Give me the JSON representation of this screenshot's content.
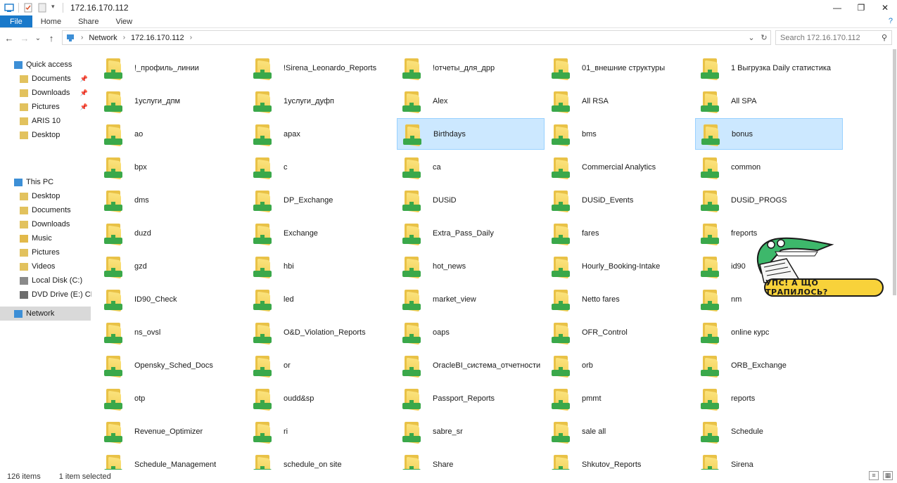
{
  "window": {
    "title": "172.16.170.112"
  },
  "ribbon": {
    "tabs": [
      "File",
      "Home",
      "Share",
      "View"
    ],
    "help_label": "?"
  },
  "nav": {
    "back": "←",
    "forward": "→",
    "recent": "⌄",
    "up": "↑"
  },
  "address": {
    "crumbs": [
      "Network",
      "172.16.170.112"
    ],
    "dropdown": "⌄",
    "refresh": "↻"
  },
  "search": {
    "placeholder": "Search 172.16.170.112"
  },
  "sidebar": {
    "items": [
      {
        "label": "Quick access",
        "icon": "star-icon",
        "pinned": false
      },
      {
        "label": "Documents",
        "icon": "documents-folder-icon",
        "pinned": true
      },
      {
        "label": "Downloads",
        "icon": "downloads-folder-icon",
        "pinned": true
      },
      {
        "label": "Pictures",
        "icon": "pictures-folder-icon",
        "pinned": true
      },
      {
        "label": "ARIS 10",
        "icon": "folder-icon",
        "pinned": false
      },
      {
        "label": "Desktop",
        "icon": "desktop-folder-icon",
        "pinned": false
      },
      {
        "label": "This PC",
        "icon": "computer-icon",
        "pinned": false
      },
      {
        "label": "Desktop",
        "icon": "desktop-folder-icon",
        "pinned": false
      },
      {
        "label": "Documents",
        "icon": "documents-folder-icon",
        "pinned": false
      },
      {
        "label": "Downloads",
        "icon": "downloads-folder-icon",
        "pinned": false
      },
      {
        "label": "Music",
        "icon": "music-folder-icon",
        "pinned": false
      },
      {
        "label": "Pictures",
        "icon": "pictures-folder-icon",
        "pinned": false
      },
      {
        "label": "Videos",
        "icon": "videos-folder-icon",
        "pinned": false
      },
      {
        "label": "Local Disk (C:)",
        "icon": "disk-icon",
        "pinned": false
      },
      {
        "label": "DVD Drive (E:) CDRO",
        "icon": "dvd-drive-icon",
        "pinned": false
      },
      {
        "label": "Network",
        "icon": "network-icon",
        "pinned": false
      }
    ]
  },
  "folders": [
    "!_профиль_линии",
    "!Sirena_Leonardo_Reports",
    "!отчеты_для_дрр",
    "01_внешние структуры",
    "1 Выгрузка Daily статистика",
    "1услуги_дпм",
    "1услуги_дуфп",
    "Alex",
    "All RSA",
    "All SPA",
    "ao",
    "apax",
    "Birthdays",
    "bms",
    "bonus",
    "bpx",
    "c",
    "ca",
    "Commercial Analytics",
    "common",
    "dms",
    "DP_Exchange",
    "DUSiD",
    "DUSiD_Events",
    "DUSiD_PROGS",
    "duzd",
    "Exchange",
    "Extra_Pass_Daily",
    "fares",
    "freports",
    "gzd",
    "hbi",
    "hot_news",
    "Hourly_Booking-Intake",
    "id90",
    "ID90_Check",
    "led",
    "market_view",
    "Netto fares",
    "nm",
    "ns_ovsl",
    "O&D_Violation_Reports",
    "oaps",
    "OFR_Control",
    "online курс",
    "Opensky_Sched_Docs",
    "or",
    "OracleBI_система_отчетности",
    "orb",
    "ORB_Exchange",
    "otp",
    "oudd&sp",
    "Passport_Reports",
    "pmmt",
    "reports",
    "Revenue_Optimizer",
    "ri",
    "sabre_sr",
    "sale all",
    "Schedule",
    "Schedule_Management",
    "schedule_on site",
    "Share",
    "Shkutov_Reports",
    "Sirena"
  ],
  "selected_folders": [
    "Birthdays",
    "bonus"
  ],
  "status": {
    "count": "126 items",
    "selection": "1 item selected"
  },
  "sticker": {
    "caption": "УПС! А ЩО ТРАПИЛОСЬ?"
  },
  "colors": {
    "accent": "#1979ca",
    "selection": "#cce8ff",
    "folder": "#f2cf55",
    "network_badge": "#3aa84a",
    "sticker": "#f8d23a",
    "crocodile": "#3db86b"
  }
}
